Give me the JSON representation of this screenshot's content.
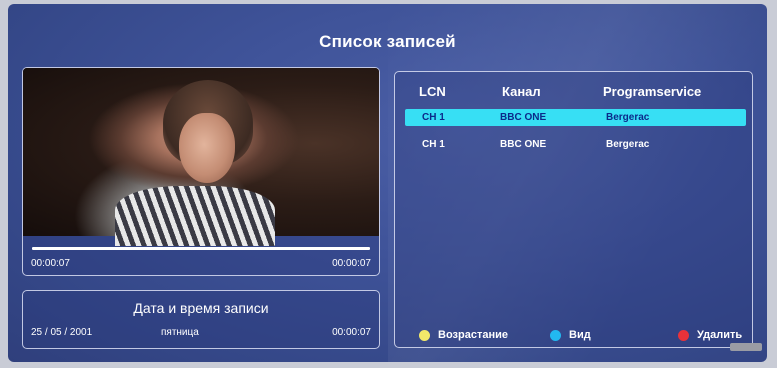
{
  "title": "Список записей",
  "player": {
    "progress_fraction": 1.0,
    "time_current": "00:00:07",
    "time_total": "00:00:07"
  },
  "record_info": {
    "title": "Дата и время записи",
    "date": "25 / 05 / 2001",
    "weekday": "пятница",
    "duration": "00:00:07"
  },
  "list": {
    "headers": {
      "lcn": "LCN",
      "channel": "Канал",
      "program": "Programservice"
    },
    "rows": [
      {
        "lcn": "CH 1",
        "channel": "BBC ONE",
        "program": "Bergerac",
        "selected": true
      },
      {
        "lcn": "CH 1",
        "channel": "BBC ONE",
        "program": "Bergerac",
        "selected": false
      }
    ]
  },
  "legend": {
    "yellow_label": "Возрастание",
    "blue_label": "Вид",
    "red_label": "Удалить",
    "colors": {
      "yellow": "#f3e96a",
      "blue": "#22b8f0",
      "red": "#e8323a"
    }
  },
  "colors": {
    "selection": "#37dff4",
    "selection_text": "#0b2a8a"
  }
}
